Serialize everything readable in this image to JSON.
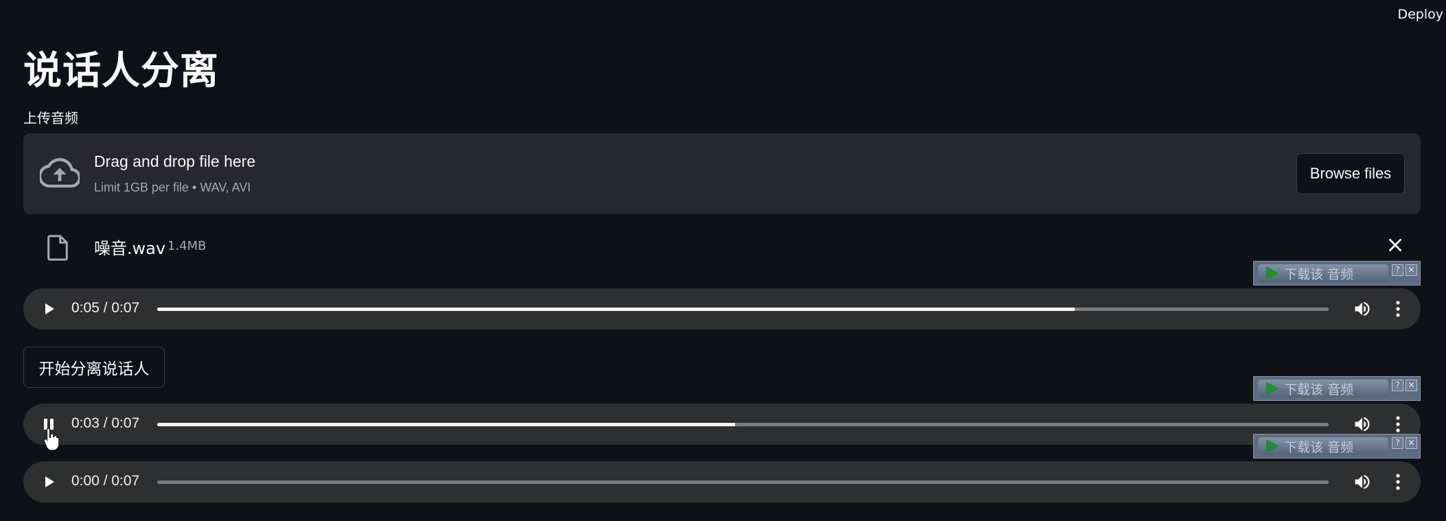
{
  "header": {
    "deploy_label": "Deploy"
  },
  "page": {
    "title": "说话人分离"
  },
  "uploader": {
    "label": "上传音频",
    "drop_text": "Drag and drop file here",
    "limit_text": "Limit 1GB per file • WAV, AVI",
    "browse_label": "Browse files",
    "cloud_icon": "cloud-upload-icon"
  },
  "file": {
    "name": "噪音.wav",
    "size": "1.4MB",
    "icon": "file-icon",
    "remove_icon": "close-icon"
  },
  "players": [
    {
      "time": "0:05 / 0:07",
      "progress": 0.7833,
      "state": "paused"
    },
    {
      "time": "0:03 / 0:07",
      "progress": 0.4933,
      "state": "playing"
    },
    {
      "time": "0:00 / 0:07",
      "progress": 0,
      "state": "paused"
    }
  ],
  "actions": {
    "start_label": "开始分离说话人"
  },
  "download_overlay": {
    "label": "下载该 音频",
    "help": "?",
    "close": "✕"
  },
  "colors": {
    "background": "#0e1117",
    "surface": "#262730",
    "player": "#2e2f31"
  }
}
